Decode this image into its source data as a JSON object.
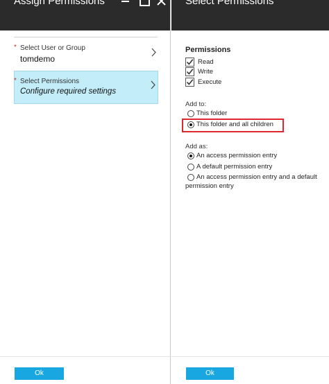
{
  "left_blade": {
    "title": "Assign Permissions",
    "window_controls": [
      "minimize-icon",
      "maximize-icon",
      "close-icon"
    ],
    "items": [
      {
        "required_marker": "*",
        "label": "Select User or Group",
        "value": "tomdemo",
        "selected": false
      },
      {
        "required_marker": "*",
        "label": "Select Permissions",
        "value": "Configure required settings",
        "selected": true
      }
    ],
    "ok_label": "Ok"
  },
  "right_blade": {
    "title": "Select Permissions",
    "permissions_heading": "Permissions",
    "permissions": [
      {
        "label": "Read",
        "checked": true
      },
      {
        "label": "Write",
        "checked": true
      },
      {
        "label": "Execute",
        "checked": true
      }
    ],
    "add_to_label": "Add to:",
    "add_to_options": [
      {
        "label": "This folder",
        "selected": false
      },
      {
        "label": "This folder and all children",
        "selected": true
      }
    ],
    "add_as_label": "Add as:",
    "add_as_options": [
      {
        "label": "An access permission entry",
        "selected": true
      },
      {
        "label": "A default permission entry",
        "selected": false
      },
      {
        "label": "An access permission entry and a default permission entry",
        "selected": false
      }
    ],
    "ok_label": "Ok"
  },
  "colors": {
    "title_bar": "#2b2b2b",
    "selected_item": "#c2edf9",
    "ok_button": "#18a7e0",
    "required_marker": "#c0392b",
    "highlight_box": "#e0262f"
  }
}
